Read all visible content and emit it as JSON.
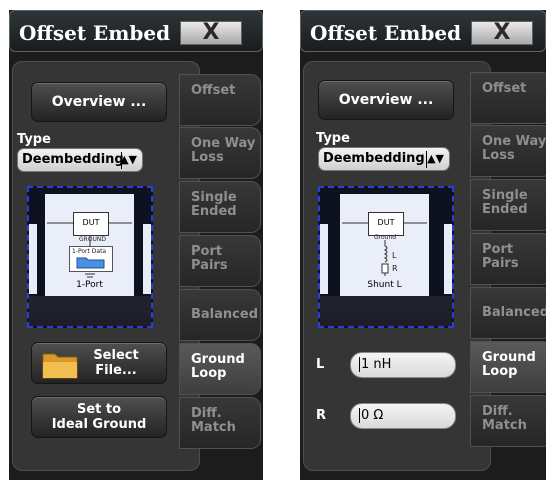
{
  "left_dialog": {
    "title": "Offset Embed",
    "close": "X",
    "overview_button": "Overview ...",
    "type_label": "Type",
    "type_value": "Deembedding",
    "select_arrows": "▲▼",
    "preview": {
      "dut": "DUT",
      "ground": "GROUND",
      "port_data": "1-Port Data",
      "caption": "1-Port"
    },
    "select_file_button": [
      "Select",
      "File..."
    ],
    "set_ideal_button": [
      "Set to",
      "Ideal Ground"
    ],
    "tabs": [
      [
        "Offset"
      ],
      [
        "One Way",
        "Loss"
      ],
      [
        "Single",
        "Ended"
      ],
      [
        "Port",
        "Pairs"
      ],
      [
        "Balanced"
      ],
      [
        "Ground",
        "Loop"
      ],
      [
        "Diff.",
        "Match"
      ]
    ]
  },
  "right_dialog": {
    "title": "Offset Embed",
    "close": "X",
    "overview_button": "Overview ...",
    "type_label": "Type",
    "type_value": "Deembedding",
    "select_arrows": "▲▼",
    "preview": {
      "dut": "DUT",
      "ground": "Ground",
      "l": "L",
      "r": "R",
      "caption": "Shunt L"
    },
    "l_label": "L",
    "l_value": "1 nH",
    "r_label": "R",
    "r_value": "0 Ω",
    "tabs": [
      [
        "Offset"
      ],
      [
        "One Way",
        "Loss"
      ],
      [
        "Single",
        "Ended"
      ],
      [
        "Port",
        "Pairs"
      ],
      [
        "Balanced"
      ],
      [
        "Ground",
        "Loop"
      ],
      [
        "Diff.",
        "Match"
      ]
    ]
  },
  "colors": {
    "active_tab_text": "#ffffff",
    "inactive_tab_text": "#8f8f8f",
    "preview_border": "#2a3fd6"
  }
}
